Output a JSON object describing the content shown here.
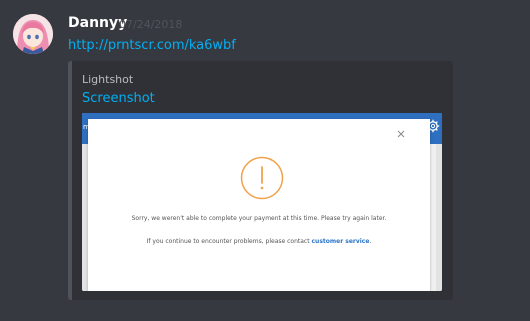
{
  "message": {
    "author": "Dannyy",
    "timestamp": "07/24/2018",
    "link": "http://prntscr.com/ka6wbf"
  },
  "embed": {
    "provider": "Lightshot",
    "title": "Screenshot",
    "screenshot": {
      "header_letter": "m",
      "dialog": {
        "message": "Sorry, we weren't able to complete your payment at this time. Please try again later.",
        "help_prefix": "If you continue to encounter problems, please contact",
        "help_link": "customer service",
        "help_suffix": "."
      }
    }
  },
  "colors": {
    "background": "#36393f",
    "link": "#00b0f4",
    "embed_bg": "#2f3136",
    "embed_border": "#4f545c",
    "site_header": "#2f6fbf",
    "alert_orange": "#f0a24a"
  },
  "icons": {
    "avatar": "anime-girl-avatar",
    "dialog_close": "close-icon",
    "alert": "exclamation-circle-icon",
    "header_settings": "gear-icon"
  }
}
